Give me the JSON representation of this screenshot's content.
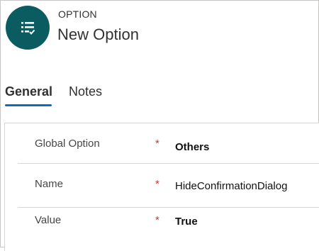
{
  "header": {
    "entity_label": "OPTION",
    "record_title": "New Option",
    "avatar_icon": "list-check-icon",
    "avatar_color": "#0b5c60"
  },
  "tabs": [
    {
      "label": "General",
      "selected": true
    },
    {
      "label": "Notes",
      "selected": false
    }
  ],
  "form": {
    "fields": [
      {
        "label": "Global Option",
        "required_marker": "*",
        "value": "Others"
      },
      {
        "label": "Name",
        "required_marker": "*",
        "value": "HideConfirmationDialog"
      },
      {
        "label": "Value",
        "required_marker": "*",
        "value": "True"
      }
    ]
  },
  "colors": {
    "accent": "#0f6cbd",
    "required": "#d13438"
  }
}
